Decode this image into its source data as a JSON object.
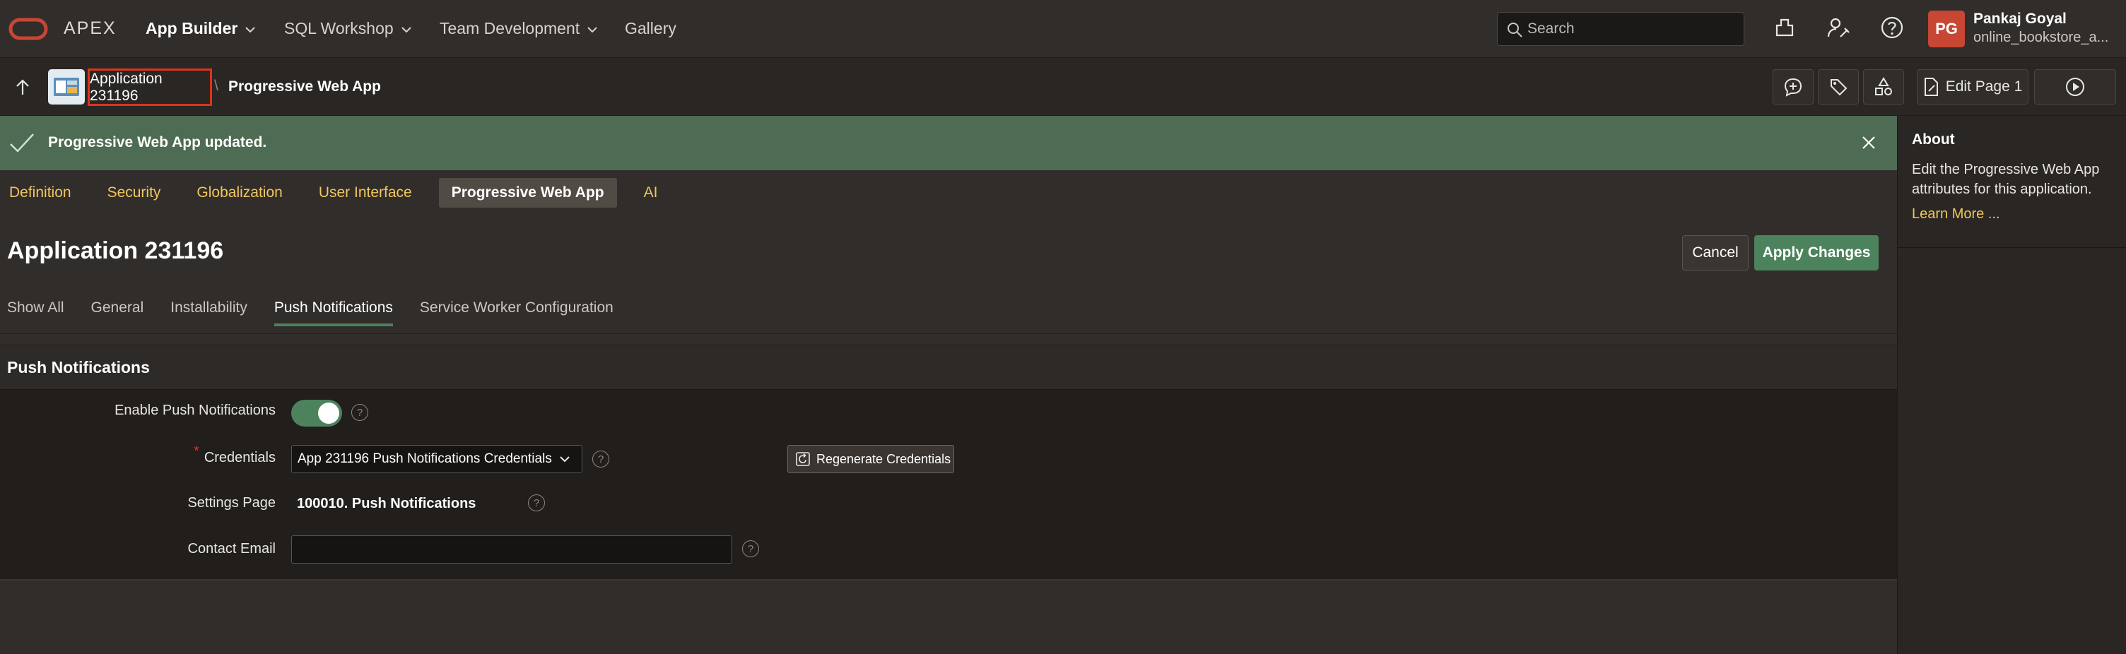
{
  "topnav": {
    "brand": "APEX",
    "menus": [
      "App Builder",
      "SQL Workshop",
      "Team Development",
      "Gallery"
    ],
    "search_placeholder": "Search",
    "user": {
      "initials": "PG",
      "name": "Pankaj Goyal",
      "workspace": "online_bookstore_a..."
    }
  },
  "breadcrumb": {
    "app": "Application 231196",
    "separator": "\\",
    "current": "Progressive Web App",
    "edit_page": "Edit Page 1"
  },
  "message": {
    "text": "Progressive Web App updated."
  },
  "tabs": [
    "Definition",
    "Security",
    "Globalization",
    "User Interface",
    "Progressive Web App",
    "AI"
  ],
  "page": {
    "title": "Application 231196",
    "cancel": "Cancel",
    "apply": "Apply Changes"
  },
  "subtabs": [
    "Show All",
    "General",
    "Installability",
    "Push Notifications",
    "Service Worker Configuration"
  ],
  "region": {
    "title": "Push Notifications",
    "fields": {
      "enable_label": "Enable Push Notifications",
      "enable_value": true,
      "credentials_label": "Credentials",
      "credentials_required_mark": "*",
      "credentials_value": "App 231196 Push Notifications Credentials",
      "regen_label": "Regenerate Credentials",
      "settings_label": "Settings Page",
      "settings_value": "100010. Push Notifications",
      "email_label": "Contact Email",
      "email_value": ""
    },
    "help_glyph": "?"
  },
  "aside": {
    "title": "About",
    "text": "Edit the Progressive Web App attributes for this application.",
    "link": "Learn More ..."
  },
  "colors": {
    "accent_green": "#4c825c",
    "link_yellow": "#f0c75e",
    "brand_red": "#c74634",
    "highlight_red": "#e0321b",
    "success_bg": "#4e6b53"
  }
}
